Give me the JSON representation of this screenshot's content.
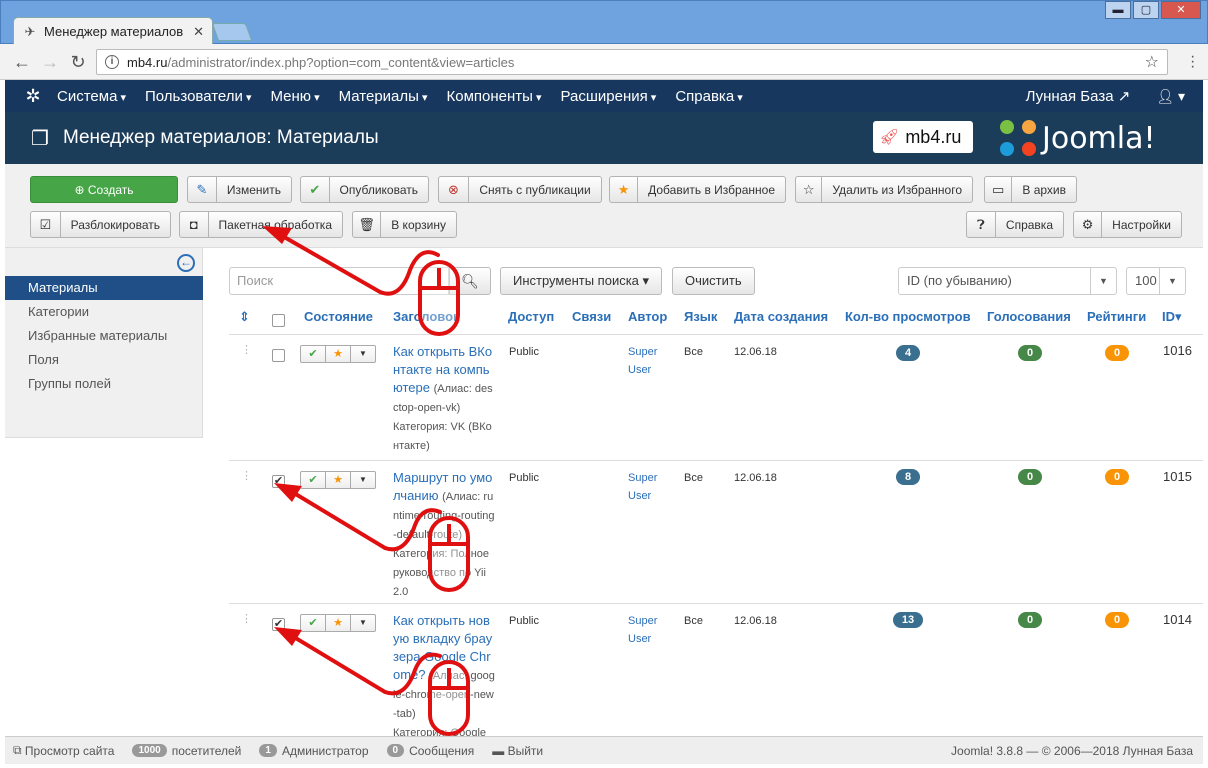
{
  "browser": {
    "tab_title": "Менеджер материалов",
    "url_host": "mb4.ru",
    "url_path": "/administrator/index.php?option=com_content&view=articles",
    "win_controls": [
      "▬",
      "▢",
      "✕"
    ]
  },
  "navbar": {
    "items": [
      "Система",
      "Пользователи",
      "Меню",
      "Материалы",
      "Компоненты",
      "Расширения",
      "Справка"
    ],
    "site_name": "Лунная База",
    "user_icon": "user-icon"
  },
  "header": {
    "title": "Менеджер материалов: Материалы",
    "mb4_logo": "mb4.ru",
    "joomla_logo": "Joomla!"
  },
  "toolbar": {
    "create": "Создать",
    "edit": "Изменить",
    "publish": "Опубликовать",
    "unpublish": "Снять с публикации",
    "feature": "Добавить в Избранное",
    "unfeature": "Удалить из Избранного",
    "archive": "В архив",
    "checkin": "Разблокировать",
    "batch": "Пакетная обработка",
    "trash": "В корзину",
    "help": "Справка",
    "options": "Настройки"
  },
  "sidebar": {
    "items": [
      "Материалы",
      "Категории",
      "Избранные материалы",
      "Поля",
      "Группы полей"
    ],
    "active": "Материалы"
  },
  "filters": {
    "search_placeholder": "Поиск",
    "search_tools": "Инструменты поиска",
    "clear": "Очистить",
    "ordering": "ID (по убыванию)",
    "limit": "100"
  },
  "table": {
    "headers": {
      "status": "Состояние",
      "title": "Заголовок",
      "access": "Доступ",
      "associations": "Связи",
      "author": "Автор",
      "language": "Язык",
      "date": "Дата создания",
      "hits": "Кол-во просмотров",
      "votes": "Голосования",
      "ratings": "Рейтинги",
      "id": "ID"
    },
    "rows": [
      {
        "title": "Как открыть ВКонтакте на компьютере",
        "alias": "(Алиас: desctop-open-vk)",
        "category": "Категория: VK (ВКонтакте)",
        "access": "Public",
        "author": "Super User",
        "language": "Все",
        "date": "12.06.18",
        "hits": "4",
        "votes": "0",
        "ratings": "0",
        "id": "1016",
        "checked": false
      },
      {
        "title": "Маршрут по умолчанию",
        "alias": "(Алиас: runtime-routing-routing-default-route)",
        "category": "Категория: Полное руководство по Yii 2.0",
        "access": "Public",
        "author": "Super User",
        "language": "Все",
        "date": "12.06.18",
        "hits": "8",
        "votes": "0",
        "ratings": "0",
        "id": "1015",
        "checked": true
      },
      {
        "title": "Как открыть новую вкладку браузера Google Chrome?",
        "alias": "(Алиас: google-chrome-open-new-tab)",
        "category": "Категория: Google",
        "access": "Public",
        "author": "Super User",
        "language": "Все",
        "date": "12.06.18",
        "hits": "13",
        "votes": "0",
        "ratings": "0",
        "id": "1014",
        "checked": true
      }
    ]
  },
  "statusbar": {
    "view_site": "Просмотр сайта",
    "visitors_count": "1000",
    "visitors_label": "посетителей",
    "admins_count": "1",
    "admins_label": "Администратор",
    "messages_count": "0",
    "messages_label": "Сообщения",
    "logout": "Выйти",
    "version": "Joomla! 3.8.8 — © 2006—2018 Лунная База"
  },
  "colors": {
    "navbar": "#17375e",
    "header": "#1c3d5a",
    "create_button": "#46a546",
    "hits_badge": "#3a6f8f",
    "votes_badge": "#468847",
    "ratings_badge": "#f89406",
    "annotation": "#e01010"
  }
}
